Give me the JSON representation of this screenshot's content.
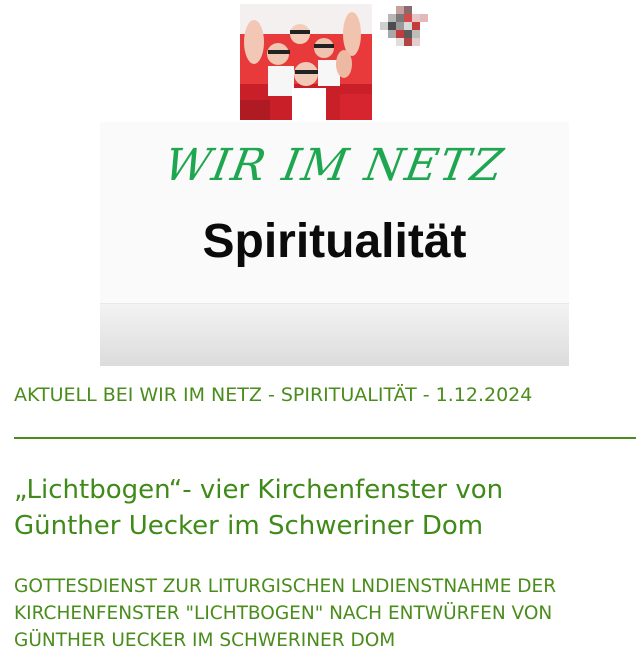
{
  "header": {
    "photo_icon": "crowd-photo",
    "mosaic_icon": "pixel-mosaic-logo",
    "brand_color": "#1fa650"
  },
  "banner": {
    "script_text": "WIR IM NETZ",
    "title": "Spiritualität"
  },
  "news": {
    "line": "AKTUELL BEI WIR IM NETZ - SPIRITUALITÄT - 1.12.2024",
    "accent_color": "#4a8d1c"
  },
  "article": {
    "headline_line1": "„Lichtbogen“- vier Kirchenfenster von",
    "headline_line2": "Günther Uecker im Schweriner Dom",
    "sub_line1": "GOTTESDIENST ZUR LITURGISCHEN LNDIENSTNAHME DER",
    "sub_line2": "KIRCHENFENSTER \"LICHTBOGEN\" NACH ENTWÜRFEN VON",
    "sub_line3": "GÜNTHER UECKER IM SCHWERINER DOM"
  }
}
